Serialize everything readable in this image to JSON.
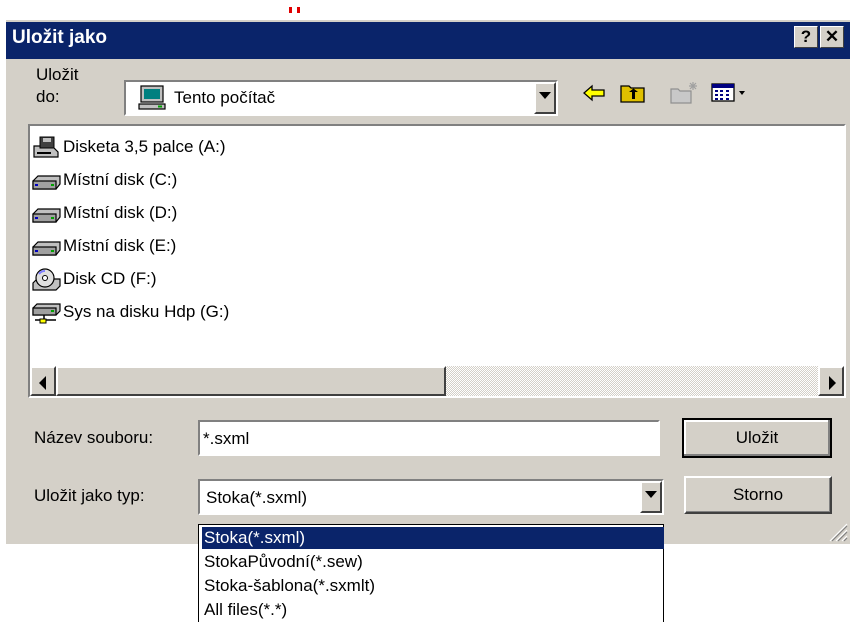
{
  "window": {
    "title": "Uložit jako",
    "help_button": "?",
    "close_button": "✕"
  },
  "save_in": {
    "label_line1": "Uložit",
    "label_line2": "do:",
    "value": "Tento počítač",
    "toolbar_icons": [
      "back-arrow-icon",
      "up-folder-icon",
      "new-folder-icon",
      "view-menu-icon"
    ]
  },
  "file_list": {
    "items": [
      {
        "label": "Disketa 3,5 palce (A:)",
        "icon": "floppy-drive-icon"
      },
      {
        "label": "Místní disk (C:)",
        "icon": "hard-drive-icon"
      },
      {
        "label": "Místní disk (D:)",
        "icon": "hard-drive-icon"
      },
      {
        "label": "Místní disk (E:)",
        "icon": "hard-drive-icon"
      },
      {
        "label": "Disk CD (F:)",
        "icon": "cd-drive-icon"
      },
      {
        "label": "Sys na disku Hdp (G:)",
        "icon": "network-drive-icon"
      }
    ]
  },
  "filename": {
    "label": "Název souboru:",
    "value": "*.sxml"
  },
  "filetype": {
    "label": "Uložit jako typ:",
    "value": "Stoka(*.sxml)",
    "options": [
      "Stoka(*.sxml)",
      "StokaPůvodní(*.sew)",
      "Stoka-šablona(*.sxmlt)",
      "All files(*.*)"
    ],
    "selected_index": 0
  },
  "buttons": {
    "save": "Uložit",
    "cancel": "Storno"
  },
  "colors": {
    "titlebar": "#0a246a",
    "face": "#d4d0c8",
    "selection": "#0a246a"
  }
}
